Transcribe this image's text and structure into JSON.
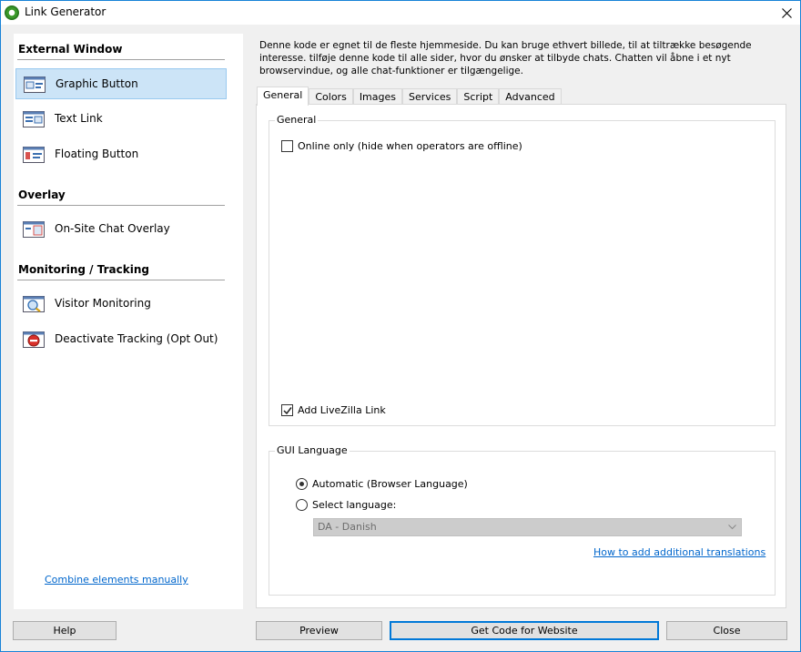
{
  "window": {
    "title": "Link Generator"
  },
  "sidebar": {
    "sections": [
      {
        "title": "External Window"
      },
      {
        "title": "Overlay"
      },
      {
        "title": "Monitoring / Tracking"
      }
    ],
    "items": [
      {
        "label": "Graphic Button",
        "icon": "graphic-button-icon",
        "selected": true
      },
      {
        "label": "Text Link",
        "icon": "text-link-icon",
        "selected": false
      },
      {
        "label": "Floating Button",
        "icon": "floating-button-icon",
        "selected": false
      },
      {
        "label": "On-Site Chat Overlay",
        "icon": "chat-overlay-icon",
        "selected": false
      },
      {
        "label": "Visitor Monitoring",
        "icon": "visitor-monitoring-icon",
        "selected": false
      },
      {
        "label": "Deactivate Tracking (Opt Out)",
        "icon": "deactivate-tracking-icon",
        "selected": false
      }
    ],
    "combine_link": "Combine elements manually"
  },
  "description": "Denne kode er egnet til de fleste hjemmeside. Du kan bruge ethvert billede, til at tiltrække besøgende interesse. tilføje denne kode til alle sider, hvor du ønsker at tilbyde chats. Chatten vil åbne i et nyt browservindue, og alle chat-funktioner er tilgængelige.",
  "tabs": [
    {
      "label": "General",
      "active": true
    },
    {
      "label": "Colors",
      "active": false
    },
    {
      "label": "Images",
      "active": false
    },
    {
      "label": "Services",
      "active": false
    },
    {
      "label": "Script",
      "active": false
    },
    {
      "label": "Advanced",
      "active": false
    }
  ],
  "general_group": {
    "title": "General",
    "online_only_label": "Online only (hide when operators are offline)",
    "online_only_checked": false,
    "add_link_label": "Add LiveZilla Link",
    "add_link_checked": true
  },
  "language_group": {
    "title": "GUI Language",
    "automatic_label": "Automatic (Browser Language)",
    "automatic_selected": true,
    "select_label": "Select language:",
    "select_selected": false,
    "language_value": "DA - Danish",
    "translations_link": "How to add additional translations"
  },
  "buttons": {
    "help": "Help",
    "preview": "Preview",
    "get_code": "Get Code for Website",
    "close": "Close"
  },
  "colors": {
    "accent": "#0078d7",
    "selected_bg": "#cce4f7",
    "link": "#0066cc"
  }
}
